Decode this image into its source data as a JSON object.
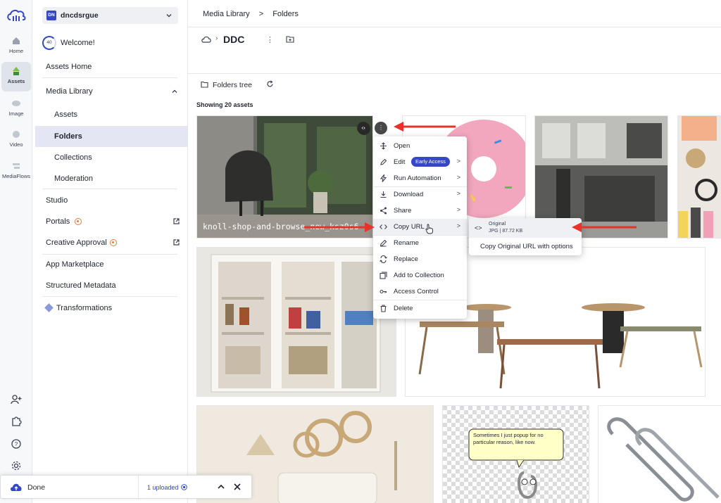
{
  "brand": {
    "accent": "#3448c5",
    "portal_dot": "#f0763a",
    "arrow_red": "#e8322a"
  },
  "rail": {
    "items": [
      {
        "label": "Home",
        "icon": "home-icon"
      },
      {
        "label": "Assets",
        "icon": "assets-icon",
        "active": true
      },
      {
        "label": "Image",
        "icon": "image-icon"
      },
      {
        "label": "Video",
        "icon": "video-icon"
      },
      {
        "label": "MediaFlows",
        "icon": "mediaflows-icon"
      }
    ],
    "bottom_icons": [
      "add-user-icon",
      "extensions-icon",
      "help-icon",
      "settings-icon"
    ]
  },
  "workspace": {
    "badge": "DN",
    "name": "dncdsrgue"
  },
  "welcome": {
    "progress": "40",
    "label": "Welcome!"
  },
  "sidebar": {
    "assets_home": "Assets Home",
    "media_library": "Media Library",
    "assets": "Assets",
    "folders": "Folders",
    "collections": "Collections",
    "moderation": "Moderation",
    "studio": "Studio",
    "portals": "Portals",
    "creative_approval": "Creative Approval",
    "app_marketplace": "App Marketplace",
    "structured_metadata": "Structured Metadata",
    "transformations": "Transformations"
  },
  "breadcrumb": {
    "root": "Media Library",
    "separator": ">",
    "current": "Folders"
  },
  "folder": {
    "name": "DDC",
    "more": "⋮"
  },
  "toolbar": {
    "folders_tree": "Folders tree"
  },
  "grid": {
    "showing": "Showing 20 assets",
    "tile_caption": "knoll-shop-and-browse_new_ksz0s6",
    "tile_btn_code": "‹›",
    "tile_btn_more": "⋮",
    "clippy_text": "Sometimes I just popup for no particular reason, like now."
  },
  "context_menu": {
    "items": [
      {
        "label": "Open",
        "icon": "move-icon"
      },
      {
        "label": "Edit",
        "icon": "edit-icon",
        "badge": "Early Access",
        "submenu": true
      },
      {
        "label": "Run Automation",
        "icon": "bolt-icon",
        "submenu": true
      },
      {
        "label": "Download",
        "icon": "download-icon",
        "submenu": true
      },
      {
        "label": "Share",
        "icon": "share-icon",
        "submenu": true
      },
      {
        "label": "Copy URL",
        "icon": "code-icon",
        "submenu": true
      },
      {
        "label": "Rename",
        "icon": "pencil-icon"
      },
      {
        "label": "Replace",
        "icon": "replace-icon"
      },
      {
        "label": "Add to Collection",
        "icon": "collection-icon"
      },
      {
        "label": "Access Control",
        "icon": "key-icon"
      },
      {
        "label": "Delete",
        "icon": "trash-icon"
      }
    ],
    "chevron": ">"
  },
  "copy_url_submenu": {
    "original_label": "Original",
    "original_meta": "JPG | 87.72 KB",
    "code_glyph": "<>",
    "with_options": "Copy Original URL with options"
  },
  "upload_toast": {
    "status": "Done",
    "uploaded": "1 uploaded"
  }
}
